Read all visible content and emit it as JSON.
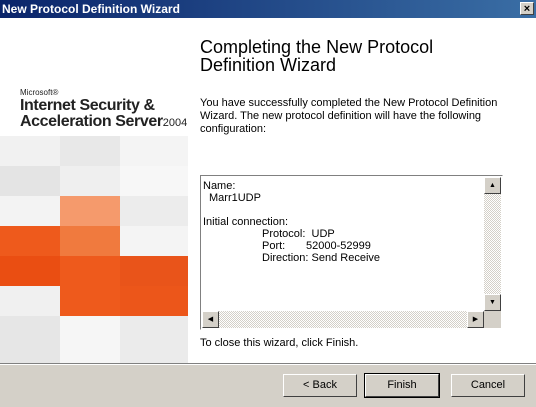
{
  "window": {
    "title": "New Protocol Definition Wizard",
    "close_glyph": "x"
  },
  "branding": {
    "company": "Microsoft®",
    "product_line1": "Internet Security &",
    "product_line2": "Acceleration Server",
    "version": "2004"
  },
  "content": {
    "heading_line1": "Completing the New Protocol",
    "heading_line2": "Definition Wizard",
    "intro": "You have successfully completed the New Protocol Definition Wizard. The new protocol definition will have the following configuration:",
    "closing": "To close this wizard, click Finish."
  },
  "configuration": {
    "name_label": "Name:",
    "name_value": "Marr1UDP",
    "initial_connection_label": "Initial connection:",
    "protocol_label": "Protocol:",
    "protocol_value": "UDP",
    "port_label": "Port:",
    "port_value": "52000-52999",
    "direction_label": "Direction:",
    "direction_value": "Send Receive"
  },
  "buttons": {
    "back_label": "< Back",
    "finish_label": "Finish",
    "cancel_label": "Cancel"
  },
  "colors": {
    "titlebar_start": "#0a246a",
    "titlebar_end": "#3a6ea5",
    "accent_orange": "#ee5a1c",
    "dialog_gray": "#d4d0c8"
  }
}
